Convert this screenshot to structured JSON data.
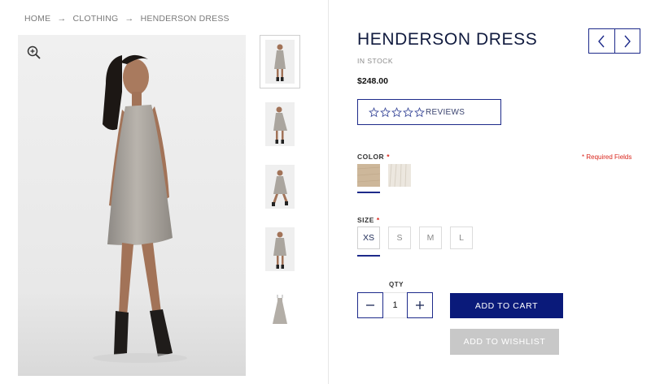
{
  "breadcrumb": {
    "items": [
      "HOME",
      "CLOTHING",
      "HENDERSON DRESS"
    ],
    "separator": "→"
  },
  "product": {
    "title": "HENDERSON DRESS",
    "stock": "IN STOCK",
    "price": "$248.00",
    "reviews_label": "REVIEWS",
    "rating": 0,
    "rating_max": 5
  },
  "color": {
    "label": "COLOR",
    "required_mark": "*",
    "options": [
      {
        "name": "tan",
        "hex": "#cdb79a",
        "selected": true
      },
      {
        "name": "cream",
        "hex": "#e9e4dc",
        "selected": false
      }
    ]
  },
  "required_note": "* Required Fields",
  "size": {
    "label": "SIZE",
    "required_mark": "*",
    "options": [
      "XS",
      "S",
      "M",
      "L"
    ],
    "selected": "XS"
  },
  "quantity": {
    "label": "QTY",
    "value": "1",
    "minus": "−",
    "plus": "+"
  },
  "buttons": {
    "add_to_cart": "ADD TO CART",
    "add_to_wishlist": "ADD TO WISHLIST"
  },
  "icons": {
    "zoom": "zoom-in-icon",
    "prev": "chevron-left-icon",
    "next": "chevron-right-icon",
    "star": "star-outline-icon"
  },
  "colors": {
    "accent": "#1d2a8a",
    "cart_button": "#0a1a7a",
    "wishlist_button": "#c8c8c8",
    "required": "#d9261c"
  }
}
